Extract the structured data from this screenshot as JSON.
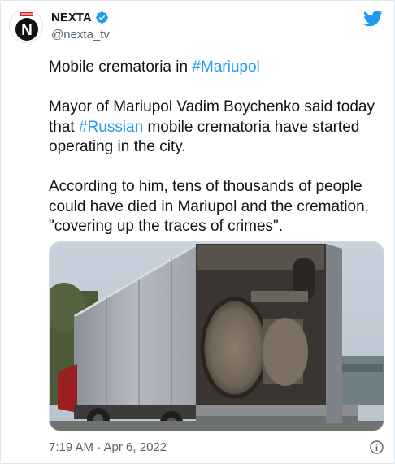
{
  "author": {
    "name": "NEXTA",
    "handle": "@nexta_tv",
    "avatar_letter": "N",
    "verified": true
  },
  "tweet": {
    "paragraphs": [
      [
        {
          "text": "Mobile crematoria in ",
          "hashtag": false
        },
        {
          "text": "#Mariupol",
          "hashtag": true
        }
      ],
      [
        {
          "text": "Mayor of Mariupol Vadim Boychenko said today that ",
          "hashtag": false
        },
        {
          "text": "#Russian",
          "hashtag": true
        },
        {
          "text": " mobile crematoria have started operating in the city.",
          "hashtag": false
        }
      ],
      [
        {
          "text": "According to him, tens of thousands of people could have died in Mariupol and the cremation, \"covering up the traces of crimes\".",
          "hashtag": false
        }
      ]
    ],
    "timestamp": "7:19 AM · Apr 6, 2022"
  },
  "icons": {
    "twitter": "twitter-bird-icon",
    "verified": "verified-badge-icon",
    "info": "info-icon"
  },
  "colors": {
    "link": "#1d9bf0",
    "verified": "#1d9bf0",
    "text": "#0f1419",
    "muted": "#536471",
    "brand_red": "#d32027"
  },
  "media": {
    "kind": "photo",
    "subject": "truck-mounted-incinerator"
  }
}
